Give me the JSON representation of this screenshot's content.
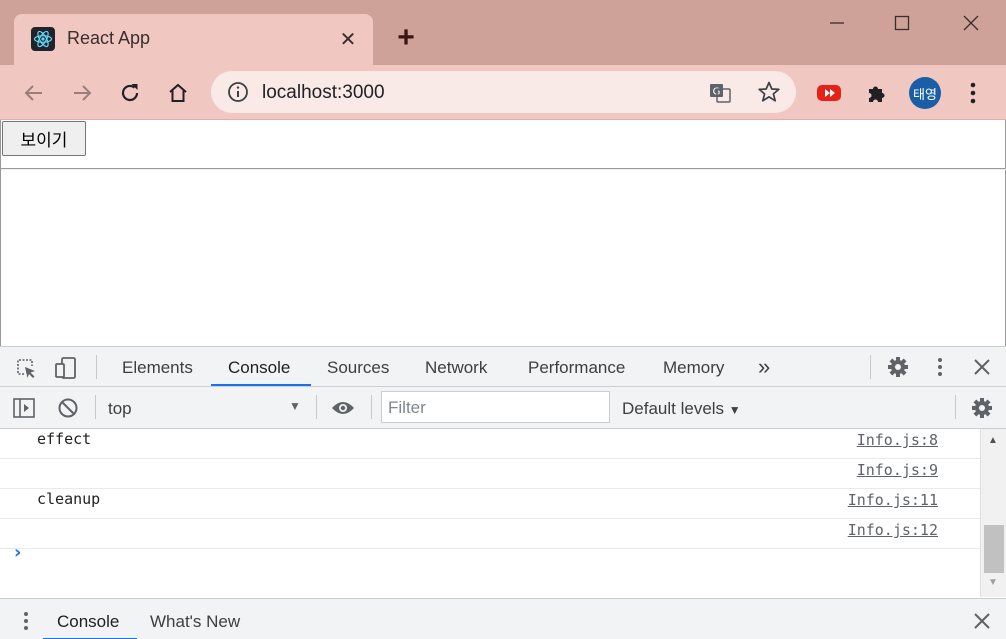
{
  "browser": {
    "tab": {
      "title": "React App",
      "favicon": "react-logo-icon",
      "close_glyph": "✕"
    },
    "new_tab_glyph": "+",
    "window_controls": {
      "minimize": "—",
      "maximize": "☐",
      "close": "✕"
    },
    "address": {
      "url": "localhost:3000",
      "icon": "info-icon"
    },
    "profile_initials": "태영",
    "colors": {
      "frame": "#cfa299",
      "toolbar": "#f1c8c1",
      "omnibox": "#faeae7",
      "avatar": "#1a5ea8"
    }
  },
  "page": {
    "show_button_label": "보이기"
  },
  "devtools": {
    "tabs": [
      "Elements",
      "Console",
      "Sources",
      "Network",
      "Performance",
      "Memory"
    ],
    "active_tab": "Console",
    "more_tabs": "»",
    "context": "top",
    "filter_placeholder": "Filter",
    "levels": "Default levels",
    "console_rows": [
      {
        "message": "effect",
        "source": "Info.js:8"
      },
      {
        "message": "",
        "source": "Info.js:9"
      },
      {
        "message": "cleanup",
        "source": "Info.js:11"
      },
      {
        "message": "",
        "source": "Info.js:12"
      }
    ],
    "prompt_glyph": "›",
    "drawer_tabs": [
      "Console",
      "What's New"
    ],
    "accent": "#1a73e8"
  }
}
